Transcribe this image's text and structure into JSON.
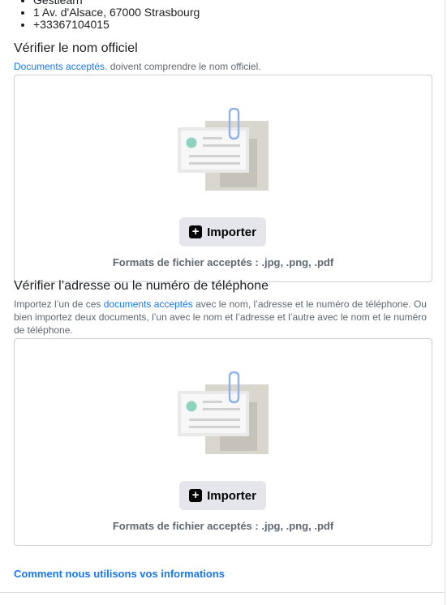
{
  "contact": {
    "items": [
      "Gestiearn",
      "1 Av. d'Alsace, 67000 Strasbourg",
      "+33367104015"
    ]
  },
  "section1": {
    "title": "Vérifier le nom officiel",
    "desc_link": "Documents acceptés",
    "desc_text": ". doivent comprendre le nom officiel.",
    "import_label": "Importer",
    "formats": "Formats de fichier acceptés : .jpg, .png, .pdf"
  },
  "section2": {
    "title": "Vérifier l’adresse ou le numéro de téléphone",
    "desc_before": "Importez l’un de ces ",
    "desc_link": "documents acceptés",
    "desc_after": " avec le nom, l’adresse et le numéro de téléphone. Ou bien importez deux documents, l’un avec le nom et l’adresse et l’autre avec le nom et le numéro de téléphone.",
    "import_label": "Importer",
    "formats": "Formats de fichier acceptés : .jpg, .png, .pdf"
  },
  "footer": {
    "link": "Comment nous utilisons vos informations"
  },
  "icons": {
    "plus": "plus-icon",
    "document": "document-illustration"
  },
  "colors": {
    "link": "#1877f2",
    "button_bg": "#e4e6eb",
    "muted_text": "#606770"
  }
}
